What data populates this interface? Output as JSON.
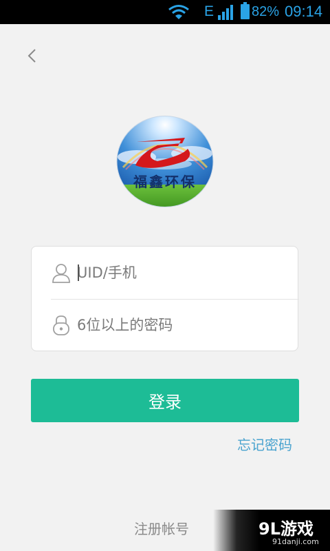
{
  "status_bar": {
    "network_type": "E",
    "battery_percent": "82%",
    "time": "09:14",
    "icons": [
      "wifi-icon",
      "signal-icon",
      "battery-icon"
    ]
  },
  "header": {
    "back_icon": "chevron-left-icon"
  },
  "logo": {
    "text": "福鑫环保"
  },
  "form": {
    "uid": {
      "placeholder": "UID/手机",
      "value": "",
      "icon": "user-icon"
    },
    "password": {
      "placeholder": "6位以上的密码",
      "value": "",
      "icon": "lock-icon"
    }
  },
  "actions": {
    "login_label": "登录",
    "forgot_label": "忘记密码",
    "register_label": "注册帐号"
  },
  "watermark": {
    "brand": "9L游戏",
    "site": "91danji.com"
  },
  "colors": {
    "accent": "#1dbc96",
    "link": "#4aa3cf",
    "background": "#f2f2f2",
    "status_icons": "#2aa3e6"
  }
}
